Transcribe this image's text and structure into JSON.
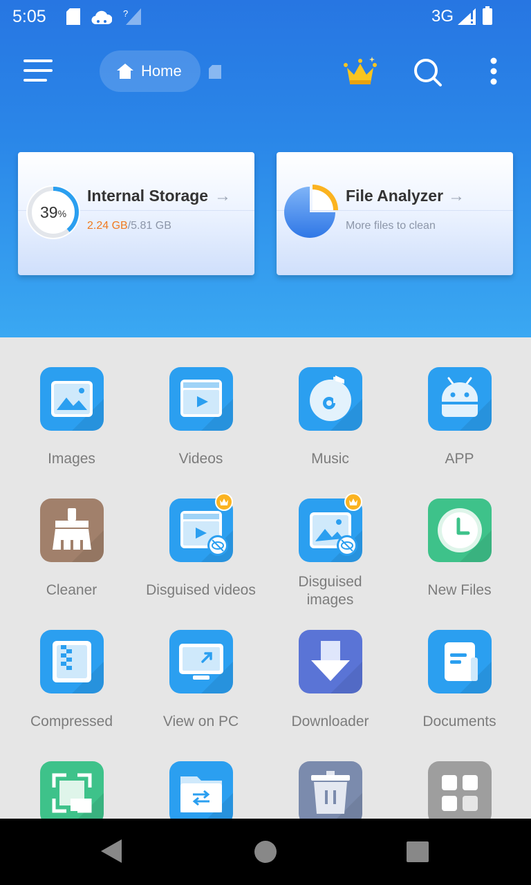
{
  "status_bar": {
    "time": "5:05",
    "network": "3G",
    "icons": [
      "sd-card-icon",
      "cloud-icon",
      "signal-unknown-icon",
      "cell-signal-icon",
      "battery-icon"
    ]
  },
  "toolbar": {
    "home_label": "Home",
    "icons": [
      "menu-icon",
      "home-icon",
      "sd-card-icon",
      "crown-icon",
      "search-icon",
      "more-icon"
    ]
  },
  "cards": {
    "storage": {
      "title": "Internal Storage",
      "percent": "39",
      "percent_sign": "%",
      "used": "2.24 GB",
      "separator": "/",
      "total": "5.81 GB",
      "usage_fraction": 0.39
    },
    "analyzer": {
      "title": "File Analyzer",
      "subtitle": "More files to clean"
    }
  },
  "tiles": [
    {
      "label": "Images",
      "icon": "image-icon"
    },
    {
      "label": "Videos",
      "icon": "video-icon"
    },
    {
      "label": "Music",
      "icon": "music-icon"
    },
    {
      "label": "APP",
      "icon": "android-icon"
    },
    {
      "label": "Cleaner",
      "icon": "broom-icon"
    },
    {
      "label": "Disguised videos",
      "icon": "disguised-video-icon",
      "vip": true
    },
    {
      "label": "Disguised images",
      "icon": "disguised-image-icon",
      "vip": true
    },
    {
      "label": "New Files",
      "icon": "clock-icon"
    },
    {
      "label": "Compressed",
      "icon": "zip-icon"
    },
    {
      "label": "View on PC",
      "icon": "monitor-icon"
    },
    {
      "label": "Downloader",
      "icon": "download-icon"
    },
    {
      "label": "Documents",
      "icon": "document-icon"
    },
    {
      "label": "",
      "icon": "screenshot-icon"
    },
    {
      "label": "",
      "icon": "transfer-folder-icon"
    },
    {
      "label": "",
      "icon": "trash-icon"
    },
    {
      "label": "",
      "icon": "more-apps-icon"
    }
  ],
  "colors": {
    "header_top": "#2776e2",
    "header_bottom": "#3aa8f2",
    "tile_blue": "#2b9ff0",
    "cleaner_brown": "#a1806b",
    "new_files_green": "#3ec28a",
    "downloader_indigo": "#5a74d6",
    "used_orange": "#f07a1e",
    "vip_gold": "#fbb320"
  },
  "nav": {
    "icons": [
      "back-icon",
      "home-circle-icon",
      "recents-icon"
    ]
  }
}
